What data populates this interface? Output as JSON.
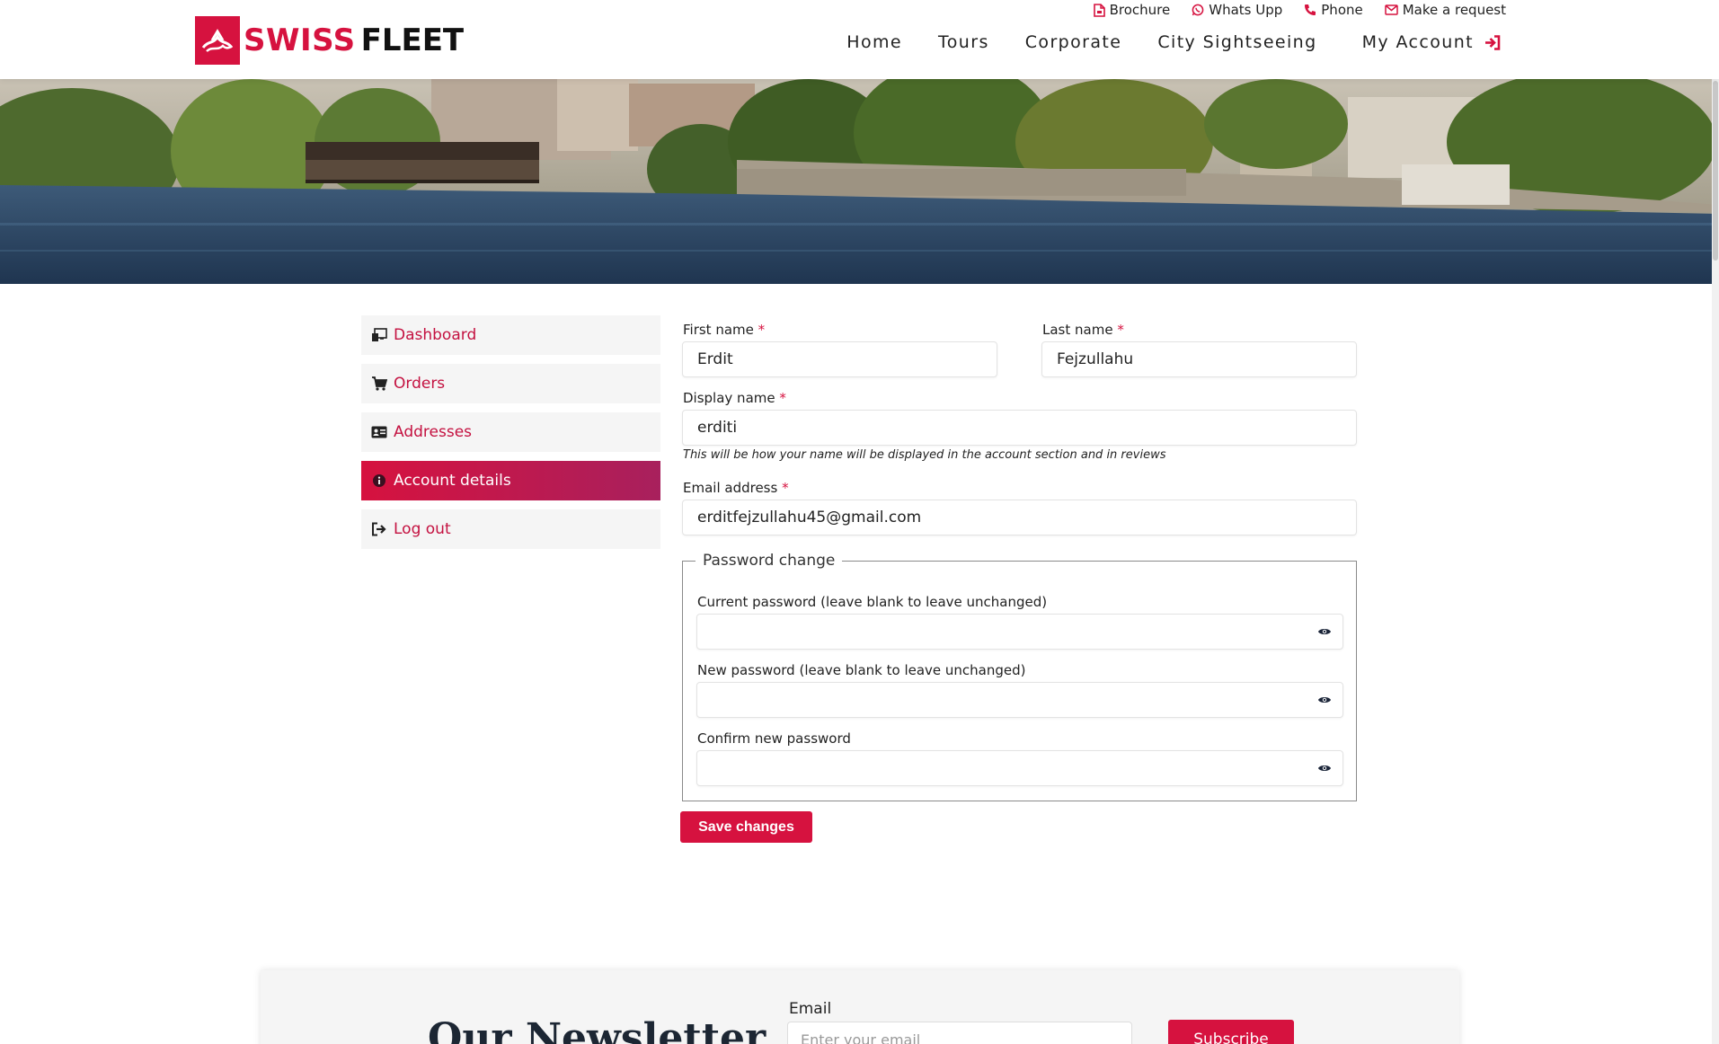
{
  "brand": {
    "name_part1": "SWISS",
    "name_part2": "FLEET",
    "accent": "#d6123f"
  },
  "topbar": [
    {
      "label": "Brochure",
      "icon": "file-pdf-icon"
    },
    {
      "label": "Whats Upp",
      "icon": "whatsapp-icon"
    },
    {
      "label": "Phone",
      "icon": "phone-icon"
    },
    {
      "label": "Make a request",
      "icon": "envelope-icon"
    }
  ],
  "nav": {
    "items": [
      "Home",
      "Tours",
      "Corporate",
      "City Sightseeing"
    ],
    "account": "My Account"
  },
  "sidebar": {
    "items": [
      {
        "label": "Dashboard",
        "icon": "dashboard-icon"
      },
      {
        "label": "Orders",
        "icon": "cart-icon"
      },
      {
        "label": "Addresses",
        "icon": "id-card-icon"
      },
      {
        "label": "Account details",
        "icon": "info-icon",
        "active": true
      },
      {
        "label": "Log out",
        "icon": "sign-out-icon"
      }
    ]
  },
  "form": {
    "first_name": {
      "label": "First name",
      "value": "Erdit"
    },
    "last_name": {
      "label": "Last name",
      "value": "Fejzullahu"
    },
    "display_name": {
      "label": "Display name",
      "value": "erditi",
      "hint": "This will be how your name will be displayed in the account section and in reviews"
    },
    "email": {
      "label": "Email address",
      "value": "erditfejzullahu45@gmail.com"
    },
    "required_mark": "*",
    "password": {
      "legend": "Password change",
      "current_label": "Current password (leave blank to leave unchanged)",
      "new_label": "New password (leave blank to leave unchanged)",
      "confirm_label": "Confirm new password"
    },
    "save_label": "Save changes"
  },
  "newsletter": {
    "title": "Our Newsletter",
    "email_label": "Email",
    "placeholder": "Enter your email",
    "button": "Subscribe"
  }
}
